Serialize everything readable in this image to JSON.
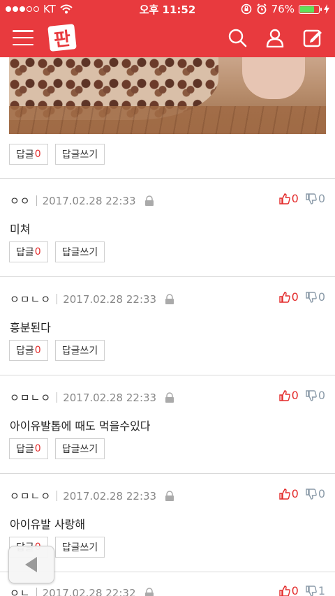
{
  "status_bar": {
    "carrier": "KT",
    "time": "오후 11:52",
    "battery": "76%",
    "battery_level": 0.76
  },
  "header": {
    "logo": "판",
    "icons": [
      "menu-icon",
      "search-icon",
      "user-icon",
      "write-icon"
    ]
  },
  "colors": {
    "brand": "#e83a3e",
    "upvote": "#e32b2b",
    "downvote": "#8a9aa8"
  },
  "top_post": {
    "reply_label": "답글",
    "reply_count": "0",
    "write_reply_label": "답글쓰기"
  },
  "comments": [
    {
      "author": "ㅇㅇ",
      "date": "2017.02.28 22:33",
      "text": "미쳐",
      "up": "0",
      "down": "0",
      "reply_label": "답글",
      "reply_count": "0",
      "write_reply_label": "답글쓰기"
    },
    {
      "author": "ㅇㅁㄴㅇ",
      "date": "2017.02.28 22:33",
      "text": "흥분된다",
      "up": "0",
      "down": "0",
      "reply_label": "답글",
      "reply_count": "0",
      "write_reply_label": "답글쓰기"
    },
    {
      "author": "ㅇㅁㄴㅇ",
      "date": "2017.02.28 22:33",
      "text": "아이유발톱에 때도 먹을수있다",
      "up": "0",
      "down": "0",
      "reply_label": "답글",
      "reply_count": "0",
      "write_reply_label": "답글쓰기"
    },
    {
      "author": "ㅇㅁㄴㅇ",
      "date": "2017.02.28 22:33",
      "text": "아이유발 사랑해",
      "up": "0",
      "down": "0",
      "reply_label": "답글",
      "reply_count": "0",
      "write_reply_label": "답글쓰기"
    },
    {
      "author": "ㅇㄴ",
      "date": "2017.02.28 22:32",
      "up": "0",
      "down": "1"
    }
  ]
}
